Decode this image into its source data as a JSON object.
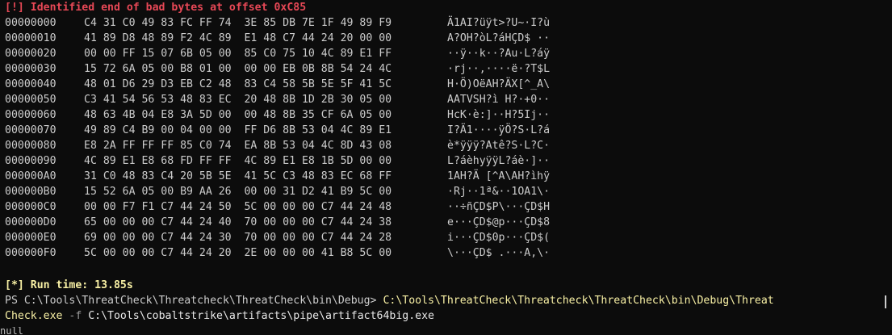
{
  "error_line": "[!] Identified end of bad bytes at offset 0xC85",
  "dump": [
    {
      "offset": "00000000",
      "hex": "C4 31 C0 49 83 FC FF 74  3E 85 DB 7E 1F 49 89 F9",
      "ascii": "Ä1AI?üÿt>?U~·I?ù"
    },
    {
      "offset": "00000010",
      "hex": "41 89 D8 48 89 F2 4C 89  E1 48 C7 44 24 20 00 00",
      "ascii": "A?OH?òL?áHÇD$ ··"
    },
    {
      "offset": "00000020",
      "hex": "00 00 FF 15 07 6B 05 00  85 C0 75 10 4C 89 E1 FF",
      "ascii": "··ÿ··k··?Au·L?áÿ"
    },
    {
      "offset": "00000030",
      "hex": "15 72 6A 05 00 B8 01 00  00 00 EB 0B 8B 54 24 4C",
      "ascii": "·rj··,····ë·?T$L"
    },
    {
      "offset": "00000040",
      "hex": "48 01 D6 29 D3 EB C2 48  83 C4 58 5B 5E 5F 41 5C",
      "ascii": "H·Ö)OëAH?ÄX[^_A\\"
    },
    {
      "offset": "00000050",
      "hex": "C3 41 54 56 53 48 83 EC  20 48 8B 1D 2B 30 05 00",
      "ascii": "AATVSH?ì H?·+0··"
    },
    {
      "offset": "00000060",
      "hex": "48 63 4B 04 E8 3A 5D 00  00 48 8B 35 CF 6A 05 00",
      "ascii": "HcK·è:]··H?5Ij··"
    },
    {
      "offset": "00000070",
      "hex": "49 89 C4 B9 00 04 00 00  FF D6 8B 53 04 4C 89 E1",
      "ascii": "I?Ä1····ÿÖ?S·L?á"
    },
    {
      "offset": "00000080",
      "hex": "E8 2A FF FF FF 85 C0 74  EA 8B 53 04 4C 8D 43 08",
      "ascii": "è*ÿÿÿ?Atê?S·L?C·"
    },
    {
      "offset": "00000090",
      "hex": "4C 89 E1 E8 68 FD FF FF  4C 89 E1 E8 1B 5D 00 00",
      "ascii": "L?áèhyÿÿL?áè·]··"
    },
    {
      "offset": "000000A0",
      "hex": "31 C0 48 83 C4 20 5B 5E  41 5C C3 48 83 EC 68 FF",
      "ascii": "1AH?Ä [^A\\AH?ìhÿ"
    },
    {
      "offset": "000000B0",
      "hex": "15 52 6A 05 00 B9 AA 26  00 00 31 D2 41 B9 5C 00",
      "ascii": "·Rj··1ª&··1OA1\\·"
    },
    {
      "offset": "000000C0",
      "hex": "00 00 F7 F1 C7 44 24 50  5C 00 00 00 C7 44 24 48",
      "ascii": "··÷ñÇD$P\\···ÇD$H"
    },
    {
      "offset": "000000D0",
      "hex": "65 00 00 00 C7 44 24 40  70 00 00 00 C7 44 24 38",
      "ascii": "e···ÇD$@p···ÇD$8"
    },
    {
      "offset": "000000E0",
      "hex": "69 00 00 00 C7 44 24 30  70 00 00 00 C7 44 24 28",
      "ascii": "i···ÇD$0p···ÇD$("
    },
    {
      "offset": "000000F0",
      "hex": "5C 00 00 00 C7 44 24 20  2E 00 00 00 41 B8 5C 00",
      "ascii": "\\···ÇD$ .···A,\\·"
    }
  ],
  "run_time": "[*] Run time: 13.85s",
  "prompt": "PS C:\\Tools\\ThreatCheck\\Threatcheck\\ThreatCheck\\bin\\Debug> ",
  "command_part1": "C:\\Tools\\ThreatCheck\\Threatcheck\\ThreatCheck\\bin\\Debug\\Threat",
  "command_part2": "Check.exe",
  "flag": " -f ",
  "argument": "C:\\Tools\\cobaltstrike\\artifacts\\pipe\\artifact64big.exe",
  "cutoff_text": "null"
}
